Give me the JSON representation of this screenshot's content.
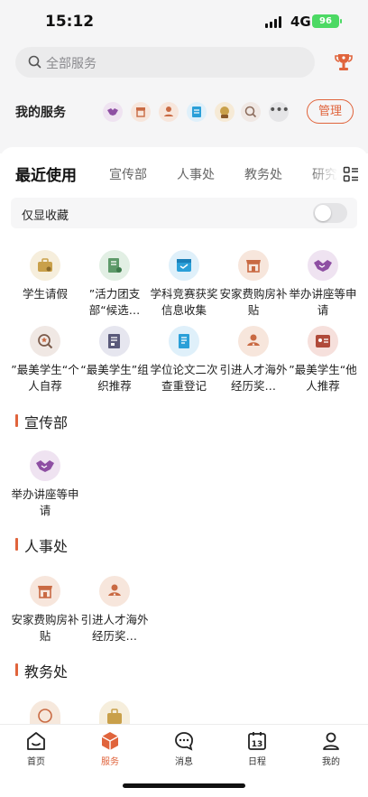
{
  "status_bar": {
    "time": "15:12",
    "network": "4G",
    "battery": "96"
  },
  "search": {
    "placeholder": "全部服务"
  },
  "my_services": {
    "label": "我的服务",
    "manage": "管理"
  },
  "tabs": [
    "最近使用",
    "宣传部",
    "人事处",
    "教务处",
    "研究"
  ],
  "favorites_only": {
    "label": "仅显收藏",
    "checked": false
  },
  "recent": [
    {
      "label": "学生请假",
      "icon": "briefcase-icon"
    },
    {
      "label": "”活力团支部“候选…",
      "icon": "certificate-icon"
    },
    {
      "label": "学科竞赛获奖信息收集",
      "icon": "form-icon"
    },
    {
      "label": "安家费购房补贴",
      "icon": "store-icon"
    },
    {
      "label": "举办讲座等申请",
      "icon": "handshake-icon"
    },
    {
      "label": "”最美学生“个人自荐",
      "icon": "star-search-icon"
    },
    {
      "label": "“最美学生”组织推荐",
      "icon": "document-icon"
    },
    {
      "label": "学位论文二次查重登记",
      "icon": "register-icon"
    },
    {
      "label": "引进人才海外经历奖…",
      "icon": "person-award-icon"
    },
    {
      "label": "”最美学生“他人推荐",
      "icon": "recommend-icon"
    }
  ],
  "sections": [
    {
      "title": "宣传部",
      "items": [
        {
          "label": "举办讲座等申请",
          "icon": "handshake-icon"
        }
      ]
    },
    {
      "title": "人事处",
      "items": [
        {
          "label": "安家费购房补贴",
          "icon": "store-icon"
        },
        {
          "label": "引进人才海外经历奖…",
          "icon": "person-award-icon"
        }
      ]
    },
    {
      "title": "教务处",
      "items": []
    }
  ],
  "bottom_nav": [
    {
      "label": "首页",
      "icon": "home-icon"
    },
    {
      "label": "服务",
      "icon": "service-box-icon",
      "active": true
    },
    {
      "label": "消息",
      "icon": "message-icon"
    },
    {
      "label": "日程",
      "icon": "calendar-icon",
      "day": "13"
    },
    {
      "label": "我的",
      "icon": "profile-icon"
    }
  ],
  "colors": {
    "accent": "#e0643c",
    "text": "#222222",
    "muted": "#8a8a8e",
    "toggle_off": "#e4e4e6"
  }
}
